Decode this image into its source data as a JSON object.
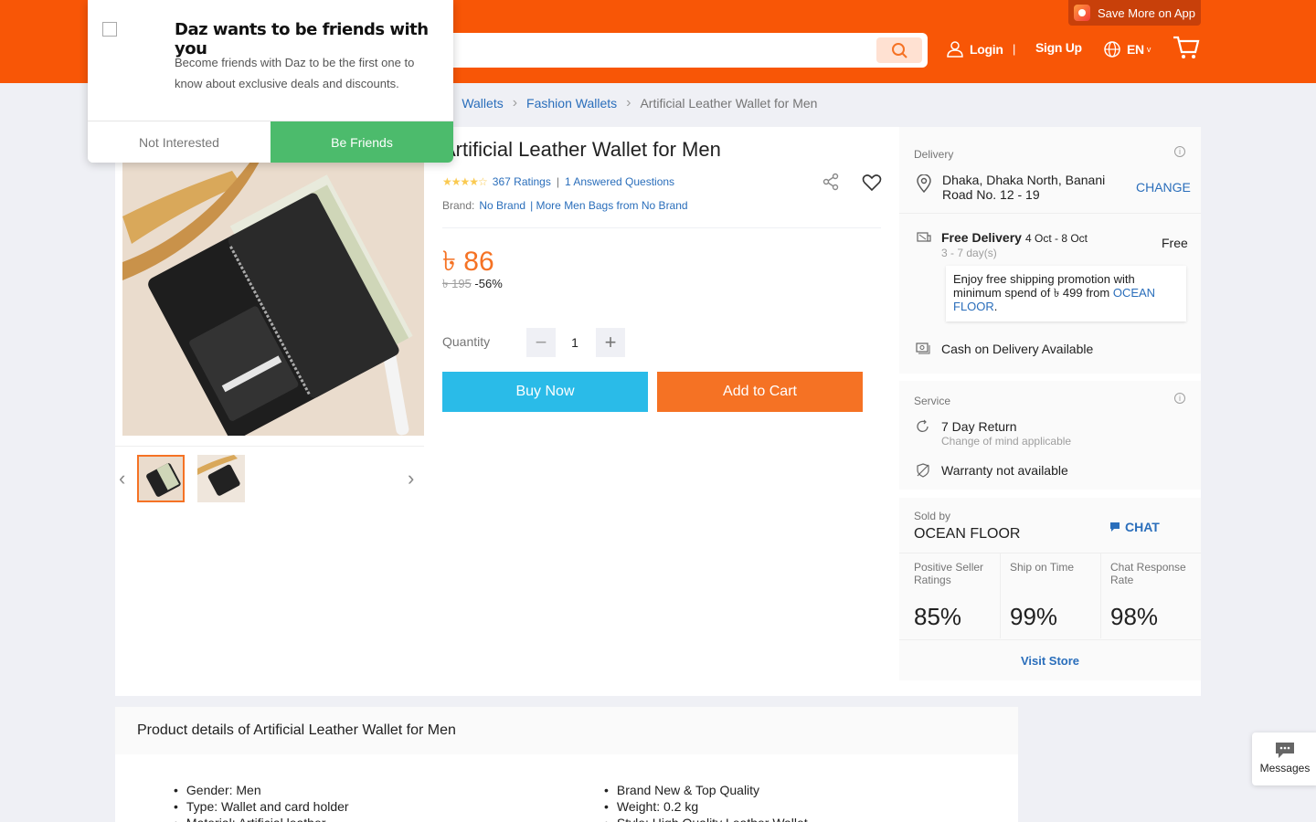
{
  "header": {
    "app_promo": "Save More on App",
    "login": "Login",
    "separator": "|",
    "signup": "Sign Up",
    "language": "EN",
    "language_caret": "v",
    "colors": {
      "bar": "#f85606",
      "search_btn": "#ffe1d2"
    }
  },
  "breadcrumb": {
    "items": [
      "Wallets",
      "Fashion Wallets"
    ],
    "current": "Artificial Leather Wallet for Men"
  },
  "popup": {
    "title": "Daz wants to be friends with you",
    "body": "Become friends with Daz to be the first one to know about exclusive deals and discounts.",
    "not_interested": "Not Interested",
    "be_friends": "Be Friends"
  },
  "product": {
    "title": "Artificial Leather Wallet for Men",
    "ratings": "367 Ratings",
    "rating_sep": "|",
    "answered": "1 Answered Questions",
    "star_rating": 4.5,
    "brand_label": "Brand:",
    "brand": "No Brand",
    "more_link": "| More Men Bags from No Brand",
    "price": "৳ 86",
    "old_price": "৳ 195",
    "discount": "-56%",
    "quantity_label": "Quantity",
    "quantity": "1",
    "buy_now": "Buy Now",
    "add_to_cart": "Add to Cart"
  },
  "delivery": {
    "title": "Delivery",
    "address": "Dhaka, Dhaka North, Banani Road No. 12 - 19",
    "change": "CHANGE",
    "free_delivery": "Free Delivery",
    "dates": "4 Oct - 8 Oct",
    "days": "3 - 7 day(s)",
    "cost": "Free",
    "promo_text": "Enjoy free shipping promotion with minimum spend of ৳ 499 from",
    "promo_store": "OCEAN FLOOR",
    "promo_end": ".",
    "cod": "Cash on Delivery Available"
  },
  "service": {
    "title": "Service",
    "return": "7 Day Return",
    "return_sub": "Change of mind applicable",
    "warranty": "Warranty not available"
  },
  "seller": {
    "sold_by": "Sold by",
    "name": "OCEAN FLOOR",
    "chat": "CHAT",
    "stats": [
      {
        "label": "Positive Seller Ratings",
        "value": "85%"
      },
      {
        "label": "Ship on Time",
        "value": "99%"
      },
      {
        "label": "Chat Response Rate",
        "value": "98%"
      }
    ],
    "visit_store": "Visit Store"
  },
  "details": {
    "heading": "Product details of Artificial Leather Wallet for Men",
    "left": [
      "Gender: Men",
      "Type: Wallet and card holder",
      "Material: Artificial leather"
    ],
    "right": [
      "Brand New & Top Quality",
      "Weight: 0.2 kg",
      "Style: High Quality Leather Wallet"
    ]
  },
  "messages": "Messages"
}
